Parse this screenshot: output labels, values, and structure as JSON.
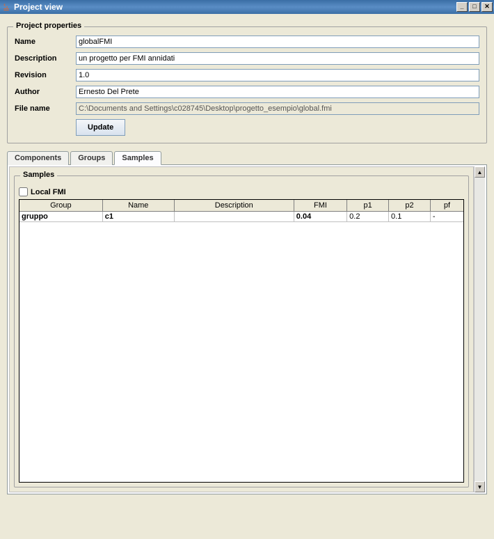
{
  "window": {
    "title": "Project view"
  },
  "properties": {
    "legend": "Project properties",
    "labels": {
      "name": "Name",
      "description": "Description",
      "revision": "Revision",
      "author": "Author",
      "filename": "File name"
    },
    "values": {
      "name": "globalFMI",
      "description": "un progetto per FMI annidati",
      "revision": "1.0",
      "author": "Ernesto Del Prete",
      "filename": "C:\\Documents and Settings\\c028745\\Desktop\\progetto_esempio\\global.fmi"
    },
    "update_label": "Update"
  },
  "tabs": {
    "items": [
      "Components",
      "Groups",
      "Samples"
    ],
    "active_index": 2
  },
  "samples": {
    "legend": "Samples",
    "local_fmi_label": "Local FMI",
    "local_fmi_checked": false,
    "columns": [
      "Group",
      "Name",
      "Description",
      "FMI",
      "p1",
      "p2",
      "pf"
    ],
    "rows": [
      {
        "group": "gruppo",
        "name": "c1",
        "description": "",
        "fmi": "0.04",
        "p1": "0.2",
        "p2": "0.1",
        "pf": "-"
      }
    ]
  }
}
